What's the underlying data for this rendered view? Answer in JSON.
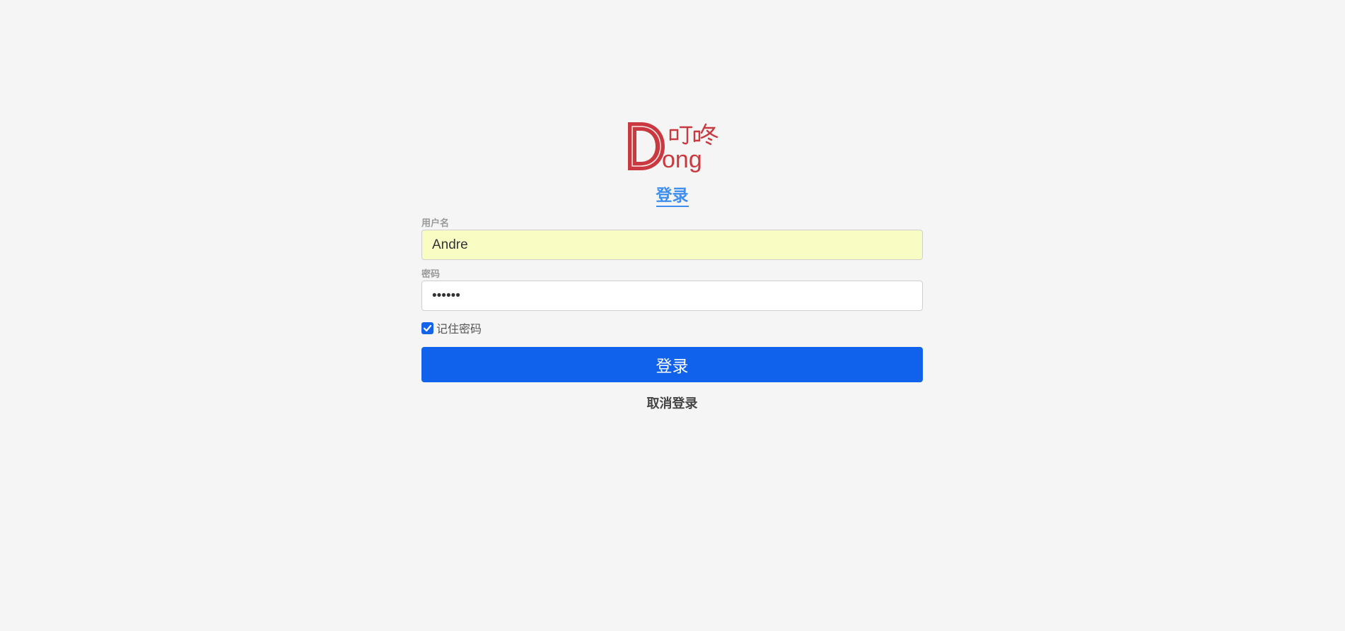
{
  "brand": {
    "logo_text": "Dong",
    "logo_cjk": "叮咚",
    "logo_color": "#c9393f"
  },
  "tabs": {
    "login_label": "登录"
  },
  "form": {
    "username_label": "用户名",
    "username_value": "Andre",
    "password_label": "密码",
    "password_value": "••••••",
    "remember_label": "记住密码",
    "remember_checked": true,
    "submit_label": "登录",
    "cancel_label": "取消登录"
  },
  "colors": {
    "accent": "#1062ed",
    "tab_active": "#3d8ef0",
    "autofill_bg": "#fafdc3",
    "page_bg": "#f5f5f5"
  }
}
